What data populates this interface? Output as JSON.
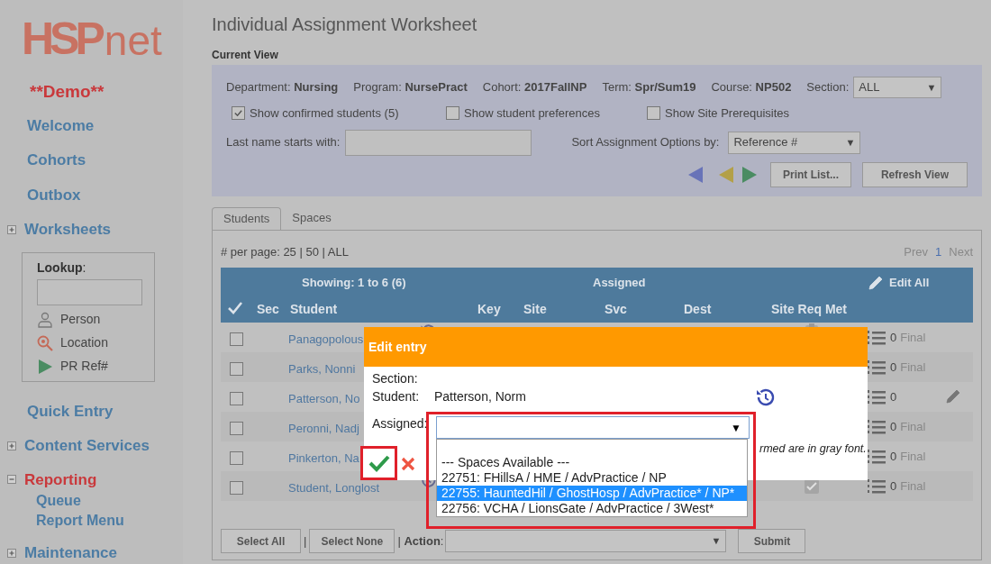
{
  "logo": {
    "part_a": "HSP",
    "part_b": "net"
  },
  "sidebar": {
    "badge": "**Demo**",
    "items": [
      {
        "kind": "link",
        "label": "Welcome",
        "selected": false
      },
      {
        "kind": "link",
        "label": "Cohorts",
        "selected": false
      },
      {
        "kind": "link",
        "label": "Outbox",
        "selected": false
      },
      {
        "kind": "group",
        "label": "Worksheets",
        "expanded": false,
        "selected": false
      },
      {
        "kind": "lookup",
        "label": "Lookup",
        "colon": ":",
        "options": [
          {
            "kind": "person",
            "label": "Person"
          },
          {
            "kind": "location",
            "label": "Location"
          },
          {
            "kind": "ref",
            "label": "PR Ref#"
          }
        ]
      },
      {
        "kind": "link",
        "label": "Quick Entry",
        "selected": false
      },
      {
        "kind": "group",
        "label": "Content Services",
        "expanded": false,
        "selected": false
      },
      {
        "kind": "group",
        "label": "Reporting",
        "expanded": true,
        "selected": true,
        "children": [
          {
            "label": "Queue"
          },
          {
            "label": "Report Menu"
          }
        ]
      },
      {
        "kind": "group",
        "label": "Maintenance",
        "expanded": false,
        "selected": false
      }
    ]
  },
  "page_title": "Individual Assignment Worksheet",
  "current_view": {
    "heading": "Current View",
    "filters": [
      {
        "label": "Department:",
        "value": "Nursing"
      },
      {
        "label": "Program:",
        "value": "NursePract"
      },
      {
        "label": "Cohort:",
        "value": "2017FallNP"
      },
      {
        "label": "Term:",
        "value": "Spr/Sum19"
      },
      {
        "label": "Course:",
        "value": "NP502"
      }
    ],
    "section": {
      "label": "Section:",
      "value": "ALL",
      "arrow": "▼"
    },
    "checkboxes": [
      {
        "label": "Show confirmed students (5)",
        "checked": true
      },
      {
        "label": "Show student preferences",
        "checked": false
      },
      {
        "label": "Show Site Prerequisites",
        "checked": false
      }
    ],
    "last_name": {
      "label": "Last name starts with:"
    },
    "sort": {
      "label": "Sort Assignment Options by:",
      "value": "Reference #",
      "arrow": "▼"
    },
    "buttons": [
      "Print List...",
      "Refresh View"
    ]
  },
  "tabs": [
    {
      "label": "Students",
      "selected": true
    },
    {
      "label": "Spaces",
      "selected": false
    }
  ],
  "per_page": "# per page: 25 | 50 | ALL",
  "pager": {
    "prev": "Prev",
    "page": "1",
    "next": "Next"
  },
  "table": {
    "showing": "Showing: 1 to 6 (6)",
    "assigned": "Assigned",
    "edit_all": "Edit All",
    "columns": [
      "Sec",
      "Student",
      "Key",
      "Site",
      "Svc",
      "Dest",
      "Site Req Met"
    ],
    "rows": [
      {
        "student": "Panagopolous",
        "checked": false,
        "history": true,
        "site_req": {
          "kind": "clipboard"
        },
        "count": "0",
        "status": "Final",
        "edit": false
      },
      {
        "student": "Parks, Nonni",
        "checked": false,
        "history": false,
        "count": "0",
        "status": "Final",
        "edit": false
      },
      {
        "student": "Patterson, No",
        "checked": false,
        "history": false,
        "count": "0",
        "edit": true
      },
      {
        "student": "Peronni, Nadj",
        "checked": false,
        "history": false,
        "count": "0",
        "status": "Final",
        "edit": false
      },
      {
        "student": "Pinkerton, Na",
        "checked": false,
        "history": false,
        "count": "0",
        "status": "Final",
        "edit": false
      },
      {
        "student": "Student, Longlost",
        "checked": false,
        "history": true,
        "site_req": {
          "kind": "met"
        },
        "count": "0",
        "status": "Final",
        "edit": false
      }
    ]
  },
  "footer": {
    "select_all": "Select All",
    "sep": "|",
    "select_none": "Select None",
    "sep2": "|",
    "action_label": "Action",
    "colon": ":",
    "action_arrow": "▼",
    "submit": "Submit"
  },
  "dialog": {
    "title": "Edit entry",
    "section_label": "Section:",
    "student_label": "Student:",
    "student_value": "Patterson, Norm",
    "assigned_label": "Assigned:",
    "select_arrow": "▼",
    "note_end": "rmed are in gray font.",
    "options": [
      {
        "label": "--- Spaces Available ---",
        "selected": false
      },
      {
        "label": "22751: FHillsA / HME / AdvPractice / NP",
        "selected": false
      },
      {
        "label": "22755: HauntedHil / GhostHosp / AdvPractice* / NP*",
        "selected": true
      },
      {
        "label": "22756: VCHA / LionsGate / AdvPractice / 3West*",
        "selected": false
      }
    ]
  }
}
